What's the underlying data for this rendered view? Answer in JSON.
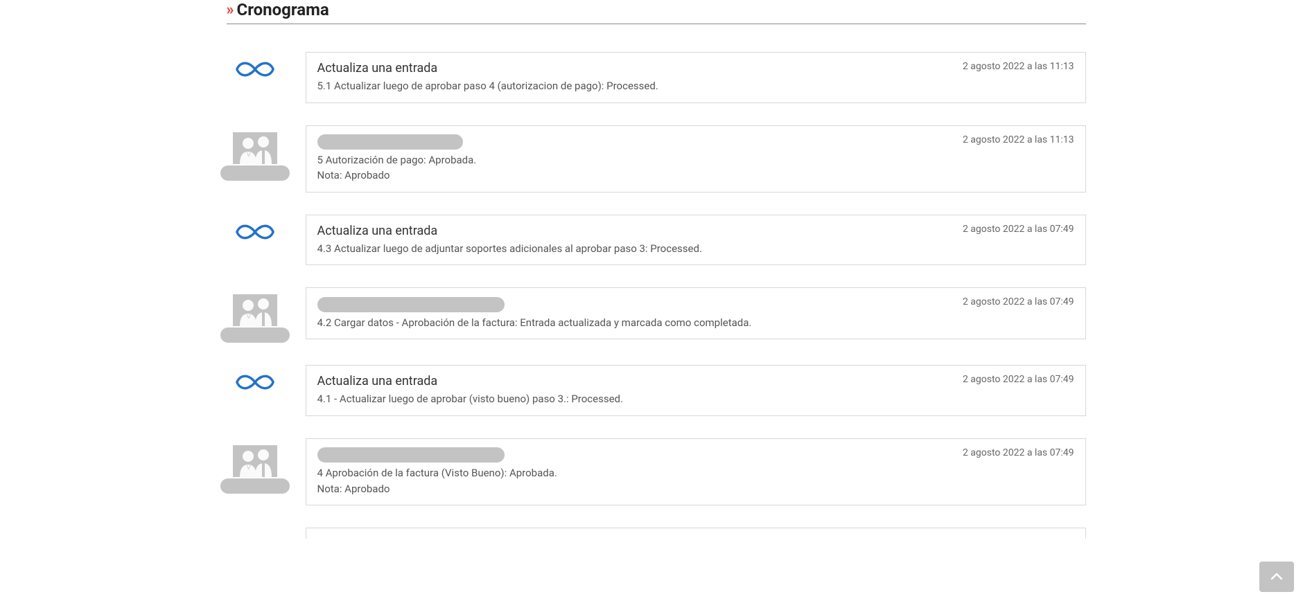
{
  "section": {
    "title": "Cronograma"
  },
  "timeline": [
    {
      "type": "system",
      "title": "Actualiza una entrada",
      "date": "2 agosto 2022 a las 11:13",
      "body": "5.1 Actualizar luego de aprobar paso 4 (autorizacion de pago): Processed.",
      "note": ""
    },
    {
      "type": "user",
      "title": "",
      "redacted_title_width": 210,
      "date": "2 agosto 2022 a las 11:13",
      "body": "5 Autorización de pago: Aprobada.",
      "note": "Nota: Aprobado"
    },
    {
      "type": "system",
      "title": "Actualiza una entrada",
      "date": "2 agosto 2022 a las 07:49",
      "body": "4.3 Actualizar luego de adjuntar soportes adicionales al aprobar paso 3: Processed.",
      "note": ""
    },
    {
      "type": "user",
      "title": "",
      "redacted_title_width": 270,
      "date": "2 agosto 2022 a las 07:49",
      "body": "4.2 Cargar datos - Aprobación de la factura: Entrada actualizada y marcada como completada.",
      "note": ""
    },
    {
      "type": "system",
      "title": "Actualiza una entrada",
      "date": "2 agosto 2022 a las 07:49",
      "body": "4.1 - Actualizar luego de aprobar (visto bueno) paso 3.: Processed.",
      "note": ""
    },
    {
      "type": "user",
      "title": "",
      "redacted_title_width": 270,
      "date": "2 agosto 2022 a las 07:49",
      "body": "4 Aprobación de la factura (Visto Bueno): Aprobada.",
      "note": "Nota: Aprobado"
    }
  ]
}
